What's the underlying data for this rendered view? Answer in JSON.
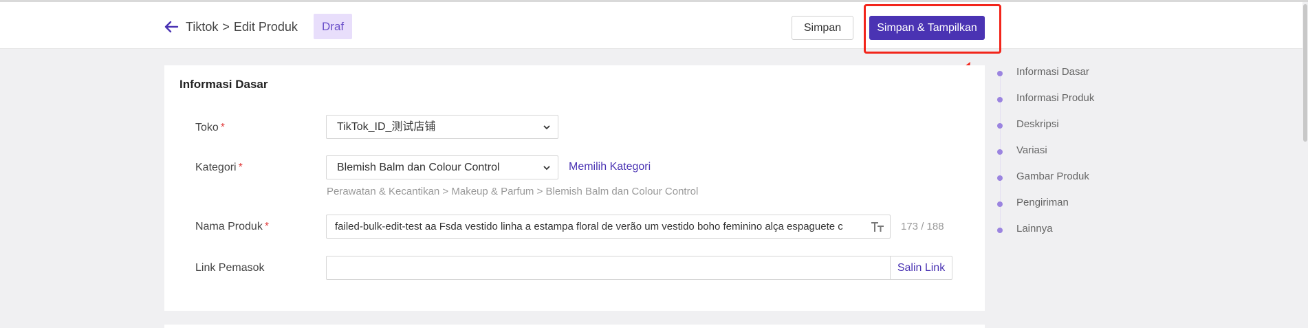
{
  "header": {
    "breadcrumb_root": "Tiktok",
    "breadcrumb_sep": ">",
    "breadcrumb_page": "Edit Produk",
    "status_badge": "Draf",
    "save_label": "Simpan",
    "save_show_label": "Simpan & Tampilkan"
  },
  "section": {
    "title": "Informasi Dasar",
    "required_mark": "*",
    "store": {
      "label": "Toko",
      "value": "TikTok_ID_测试店铺"
    },
    "category": {
      "label": "Kategori",
      "value": "Blemish Balm dan Colour Control",
      "link": "Memilih Kategori",
      "path": "Perawatan & Kecantikan > Makeup & Parfum > Blemish Balm dan Colour Control"
    },
    "product_name": {
      "label": "Nama Produk",
      "value": "failed-bulk-edit-test aa Fsda vestido linha a estampa floral de verão um vestido boho feminino alça espaguete c",
      "counter": "173 / 188"
    },
    "supplier_link": {
      "label": "Link Pemasok",
      "value": "",
      "copy_label": "Salin Link"
    }
  },
  "side_nav": {
    "items": [
      {
        "label": "Informasi Dasar"
      },
      {
        "label": "Informasi Produk"
      },
      {
        "label": "Deskripsi"
      },
      {
        "label": "Variasi"
      },
      {
        "label": "Gambar Produk"
      },
      {
        "label": "Pengiriman"
      },
      {
        "label": "Lainnya"
      }
    ]
  },
  "colors": {
    "primary": "#4a33b3",
    "badge_bg": "#e8defb",
    "highlight": "#f2251b",
    "nav_dot": "#9b84e0"
  },
  "icons": {
    "back": "arrow-left-icon",
    "dropdown": "chevron-down-icon",
    "font_size": "font-size-icon"
  }
}
